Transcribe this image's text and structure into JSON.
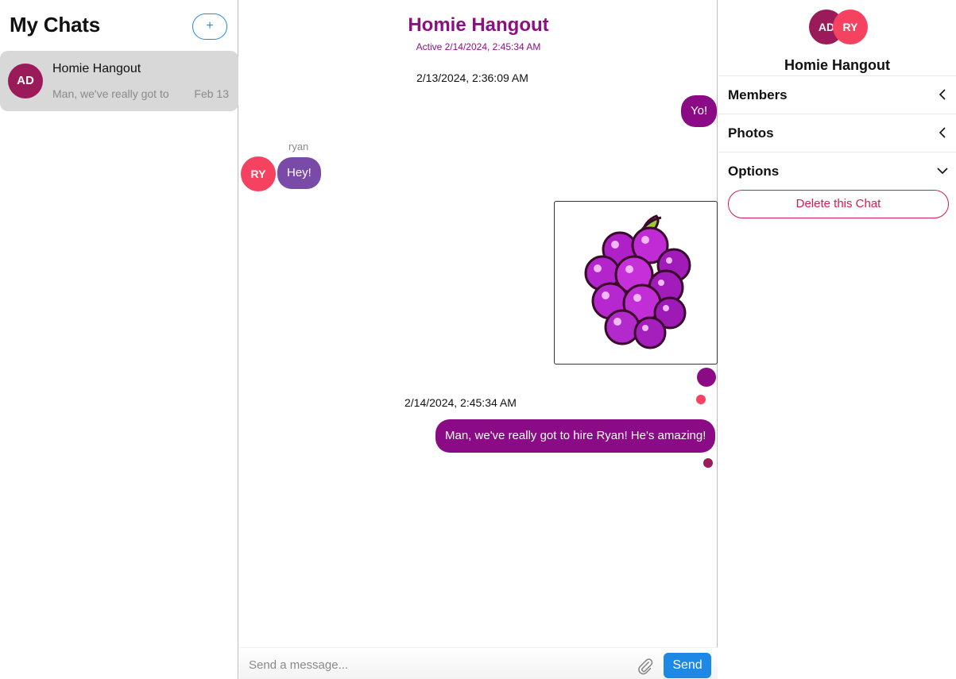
{
  "sidebar": {
    "title": "My Chats",
    "new_chat_label": "+",
    "chats": [
      {
        "avatar_initials": "AD",
        "name": "Homie Hangout",
        "preview": "Man, we've really got to hire Ryan! He's amazing!",
        "date": "Feb 13"
      }
    ]
  },
  "chat": {
    "title": "Homie Hangout",
    "status": "Active 2/14/2024, 2:45:34 AM",
    "messages": [
      {
        "timestamp": "2/13/2024, 2:36:09 AM"
      },
      {
        "own": true,
        "text": "Yo!"
      },
      {
        "sender": "ryan",
        "avatar_initials": "RY",
        "text": "Hey!"
      },
      {
        "own": true,
        "image": "grapes-sticker"
      },
      {
        "timestamp": "2/14/2024, 2:45:34 AM"
      },
      {
        "own": true,
        "text": "Man, we've really got to hire Ryan! He's amazing!"
      }
    ]
  },
  "composer": {
    "placeholder": "Send a message...",
    "attach_icon": "paperclip-icon",
    "send_label": "Send"
  },
  "details": {
    "avatars": [
      "AD",
      "RY"
    ],
    "title": "Homie Hangout",
    "sections": [
      {
        "label": "Members",
        "icon": "chevron-left-icon"
      },
      {
        "label": "Photos",
        "icon": "chevron-left-icon"
      },
      {
        "label": "Options",
        "icon": "chevron-down-icon"
      }
    ],
    "delete_label": "Delete this Chat"
  },
  "colors": {
    "accent_purple": "#8b1182",
    "own_bubble": "#8b0a85",
    "other_bubble": "#7a4aa8",
    "avatar_ad": "#9b1a59",
    "avatar_ry": "#f54260",
    "primary_blue": "#1e88e5",
    "danger": "#d81b4e"
  }
}
